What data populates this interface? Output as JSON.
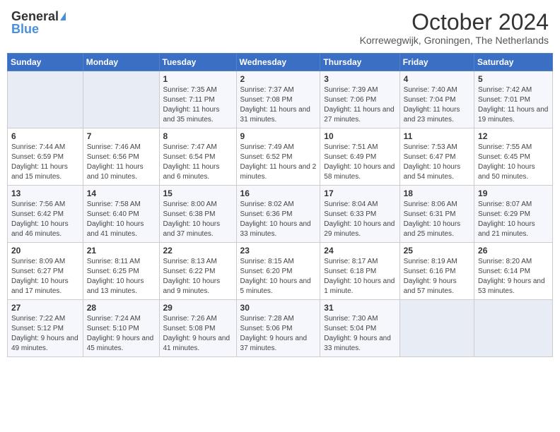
{
  "header": {
    "logo_general": "General",
    "logo_blue": "Blue",
    "month_year": "October 2024",
    "location": "Korrewegwijk, Groningen, The Netherlands"
  },
  "columns": [
    "Sunday",
    "Monday",
    "Tuesday",
    "Wednesday",
    "Thursday",
    "Friday",
    "Saturday"
  ],
  "weeks": [
    [
      {
        "day": "",
        "sunrise": "",
        "sunset": "",
        "daylight": ""
      },
      {
        "day": "",
        "sunrise": "",
        "sunset": "",
        "daylight": ""
      },
      {
        "day": "1",
        "sunrise": "Sunrise: 7:35 AM",
        "sunset": "Sunset: 7:11 PM",
        "daylight": "Daylight: 11 hours and 35 minutes."
      },
      {
        "day": "2",
        "sunrise": "Sunrise: 7:37 AM",
        "sunset": "Sunset: 7:08 PM",
        "daylight": "Daylight: 11 hours and 31 minutes."
      },
      {
        "day": "3",
        "sunrise": "Sunrise: 7:39 AM",
        "sunset": "Sunset: 7:06 PM",
        "daylight": "Daylight: 11 hours and 27 minutes."
      },
      {
        "day": "4",
        "sunrise": "Sunrise: 7:40 AM",
        "sunset": "Sunset: 7:04 PM",
        "daylight": "Daylight: 11 hours and 23 minutes."
      },
      {
        "day": "5",
        "sunrise": "Sunrise: 7:42 AM",
        "sunset": "Sunset: 7:01 PM",
        "daylight": "Daylight: 11 hours and 19 minutes."
      }
    ],
    [
      {
        "day": "6",
        "sunrise": "Sunrise: 7:44 AM",
        "sunset": "Sunset: 6:59 PM",
        "daylight": "Daylight: 11 hours and 15 minutes."
      },
      {
        "day": "7",
        "sunrise": "Sunrise: 7:46 AM",
        "sunset": "Sunset: 6:56 PM",
        "daylight": "Daylight: 11 hours and 10 minutes."
      },
      {
        "day": "8",
        "sunrise": "Sunrise: 7:47 AM",
        "sunset": "Sunset: 6:54 PM",
        "daylight": "Daylight: 11 hours and 6 minutes."
      },
      {
        "day": "9",
        "sunrise": "Sunrise: 7:49 AM",
        "sunset": "Sunset: 6:52 PM",
        "daylight": "Daylight: 11 hours and 2 minutes."
      },
      {
        "day": "10",
        "sunrise": "Sunrise: 7:51 AM",
        "sunset": "Sunset: 6:49 PM",
        "daylight": "Daylight: 10 hours and 58 minutes."
      },
      {
        "day": "11",
        "sunrise": "Sunrise: 7:53 AM",
        "sunset": "Sunset: 6:47 PM",
        "daylight": "Daylight: 10 hours and 54 minutes."
      },
      {
        "day": "12",
        "sunrise": "Sunrise: 7:55 AM",
        "sunset": "Sunset: 6:45 PM",
        "daylight": "Daylight: 10 hours and 50 minutes."
      }
    ],
    [
      {
        "day": "13",
        "sunrise": "Sunrise: 7:56 AM",
        "sunset": "Sunset: 6:42 PM",
        "daylight": "Daylight: 10 hours and 46 minutes."
      },
      {
        "day": "14",
        "sunrise": "Sunrise: 7:58 AM",
        "sunset": "Sunset: 6:40 PM",
        "daylight": "Daylight: 10 hours and 41 minutes."
      },
      {
        "day": "15",
        "sunrise": "Sunrise: 8:00 AM",
        "sunset": "Sunset: 6:38 PM",
        "daylight": "Daylight: 10 hours and 37 minutes."
      },
      {
        "day": "16",
        "sunrise": "Sunrise: 8:02 AM",
        "sunset": "Sunset: 6:36 PM",
        "daylight": "Daylight: 10 hours and 33 minutes."
      },
      {
        "day": "17",
        "sunrise": "Sunrise: 8:04 AM",
        "sunset": "Sunset: 6:33 PM",
        "daylight": "Daylight: 10 hours and 29 minutes."
      },
      {
        "day": "18",
        "sunrise": "Sunrise: 8:06 AM",
        "sunset": "Sunset: 6:31 PM",
        "daylight": "Daylight: 10 hours and 25 minutes."
      },
      {
        "day": "19",
        "sunrise": "Sunrise: 8:07 AM",
        "sunset": "Sunset: 6:29 PM",
        "daylight": "Daylight: 10 hours and 21 minutes."
      }
    ],
    [
      {
        "day": "20",
        "sunrise": "Sunrise: 8:09 AM",
        "sunset": "Sunset: 6:27 PM",
        "daylight": "Daylight: 10 hours and 17 minutes."
      },
      {
        "day": "21",
        "sunrise": "Sunrise: 8:11 AM",
        "sunset": "Sunset: 6:25 PM",
        "daylight": "Daylight: 10 hours and 13 minutes."
      },
      {
        "day": "22",
        "sunrise": "Sunrise: 8:13 AM",
        "sunset": "Sunset: 6:22 PM",
        "daylight": "Daylight: 10 hours and 9 minutes."
      },
      {
        "day": "23",
        "sunrise": "Sunrise: 8:15 AM",
        "sunset": "Sunset: 6:20 PM",
        "daylight": "Daylight: 10 hours and 5 minutes."
      },
      {
        "day": "24",
        "sunrise": "Sunrise: 8:17 AM",
        "sunset": "Sunset: 6:18 PM",
        "daylight": "Daylight: 10 hours and 1 minute."
      },
      {
        "day": "25",
        "sunrise": "Sunrise: 8:19 AM",
        "sunset": "Sunset: 6:16 PM",
        "daylight": "Daylight: 9 hours and 57 minutes."
      },
      {
        "day": "26",
        "sunrise": "Sunrise: 8:20 AM",
        "sunset": "Sunset: 6:14 PM",
        "daylight": "Daylight: 9 hours and 53 minutes."
      }
    ],
    [
      {
        "day": "27",
        "sunrise": "Sunrise: 7:22 AM",
        "sunset": "Sunset: 5:12 PM",
        "daylight": "Daylight: 9 hours and 49 minutes."
      },
      {
        "day": "28",
        "sunrise": "Sunrise: 7:24 AM",
        "sunset": "Sunset: 5:10 PM",
        "daylight": "Daylight: 9 hours and 45 minutes."
      },
      {
        "day": "29",
        "sunrise": "Sunrise: 7:26 AM",
        "sunset": "Sunset: 5:08 PM",
        "daylight": "Daylight: 9 hours and 41 minutes."
      },
      {
        "day": "30",
        "sunrise": "Sunrise: 7:28 AM",
        "sunset": "Sunset: 5:06 PM",
        "daylight": "Daylight: 9 hours and 37 minutes."
      },
      {
        "day": "31",
        "sunrise": "Sunrise: 7:30 AM",
        "sunset": "Sunset: 5:04 PM",
        "daylight": "Daylight: 9 hours and 33 minutes."
      },
      {
        "day": "",
        "sunrise": "",
        "sunset": "",
        "daylight": ""
      },
      {
        "day": "",
        "sunrise": "",
        "sunset": "",
        "daylight": ""
      }
    ]
  ]
}
